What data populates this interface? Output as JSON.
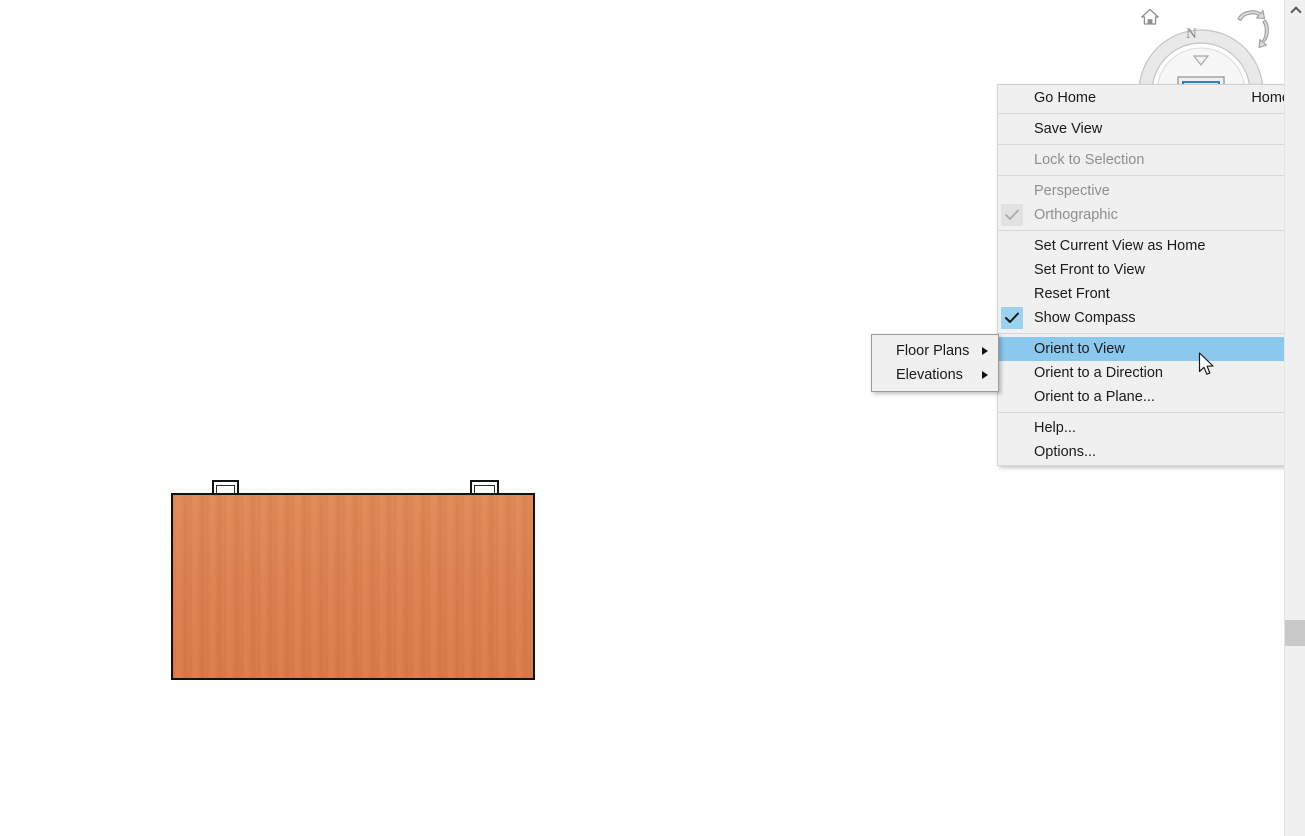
{
  "app": {
    "viewport_background": "#ffffff",
    "highlight_color": "#8cc8ee",
    "menu_background": "#f0f0f0",
    "model_color": "#dd8150"
  },
  "viewcube": {
    "home_icon": "home-icon",
    "turn_icon": "rotate-arrow-icon",
    "compass_icon": "compass-ring-icon",
    "north_label": "N",
    "cube_icon": "view-cube-icon"
  },
  "context_menu": {
    "items": [
      {
        "id": "go-home",
        "label": "Go Home",
        "shortcut": "Home",
        "state": "normal",
        "check": "none",
        "submenu": false
      },
      {
        "id": "save-view",
        "label": "Save View",
        "shortcut": "",
        "state": "normal",
        "check": "none",
        "submenu": false
      },
      {
        "id": "lock-to-selection",
        "label": "Lock to Selection",
        "shortcut": "",
        "state": "disabled",
        "check": "none",
        "submenu": false
      },
      {
        "id": "perspective",
        "label": "Perspective",
        "shortcut": "",
        "state": "disabled",
        "check": "none",
        "submenu": false
      },
      {
        "id": "orthographic",
        "label": "Orthographic",
        "shortcut": "",
        "state": "disabled",
        "check": "gray",
        "submenu": false
      },
      {
        "id": "set-current-view-as-home",
        "label": "Set Current View as Home",
        "shortcut": "",
        "state": "normal",
        "check": "none",
        "submenu": false
      },
      {
        "id": "set-front-to-view",
        "label": "Set Front to View",
        "shortcut": "",
        "state": "normal",
        "check": "none",
        "submenu": true
      },
      {
        "id": "reset-front",
        "label": "Reset Front",
        "shortcut": "",
        "state": "normal",
        "check": "none",
        "submenu": false
      },
      {
        "id": "show-compass",
        "label": "Show Compass",
        "shortcut": "",
        "state": "normal",
        "check": "blue",
        "submenu": false
      },
      {
        "id": "orient-to-view",
        "label": "Orient to View",
        "shortcut": "",
        "state": "highlighted",
        "check": "none",
        "submenu": true
      },
      {
        "id": "orient-to-a-direction",
        "label": "Orient to a Direction",
        "shortcut": "",
        "state": "normal",
        "check": "none",
        "submenu": true
      },
      {
        "id": "orient-to-a-plane",
        "label": "Orient to a Plane...",
        "shortcut": "",
        "state": "normal",
        "check": "none",
        "submenu": false
      },
      {
        "id": "help",
        "label": "Help...",
        "shortcut": "",
        "state": "normal",
        "check": "none",
        "submenu": false
      },
      {
        "id": "options",
        "label": "Options...",
        "shortcut": "",
        "state": "normal",
        "check": "none",
        "submenu": false
      }
    ]
  },
  "submenu": {
    "items": [
      {
        "id": "floor-plans",
        "label": "Floor Plans",
        "submenu": true
      },
      {
        "id": "elevations",
        "label": "Elevations",
        "submenu": true
      }
    ]
  },
  "scrollbar": {
    "up_arrow_icon": "chevron-up-icon",
    "thumb": "scrollbar-thumb"
  },
  "cursor": {
    "icon": "mouse-pointer-icon"
  }
}
